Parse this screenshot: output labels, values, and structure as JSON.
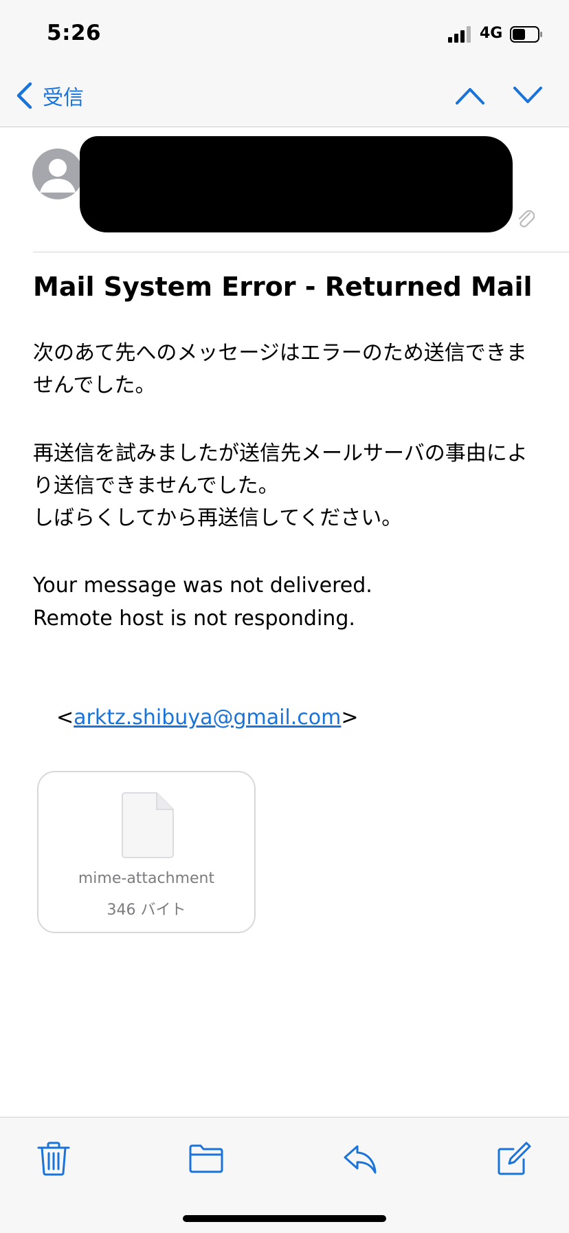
{
  "status_bar": {
    "time": "5:26",
    "network": "4G",
    "icons": [
      "signal-icon",
      "battery-icon"
    ]
  },
  "nav": {
    "back_label": "受信",
    "icons": [
      "chevron-left-icon",
      "chevron-up-icon",
      "chevron-down-icon"
    ]
  },
  "message": {
    "subject": "Mail System Error - Returned Mail",
    "jp_paragraph_1": "次のあて先へのメッセージはエラーのため送信できませんでした。",
    "jp_paragraph_2_line_1": "再送信を試みましたが送信先メールサーバの事由により送信できませんでした。",
    "jp_paragraph_2_line_2": "しばらくしてから再送信してください。",
    "en_line_1": "Your message was not delivered.",
    "en_line_2": "Remote host is not responding.",
    "email_open": "<",
    "email": "arktz.shibuya@gmail.com",
    "email_close": ">"
  },
  "attachment": {
    "name": "mime-attachment",
    "size": "346 バイト"
  },
  "toolbar": {
    "icons": [
      "trash-icon",
      "folder-icon",
      "reply-icon",
      "compose-icon"
    ]
  },
  "colors": {
    "accent": "#1a73d9",
    "bar_background": "#f7f7f7",
    "secondary_text": "#7b7b80"
  }
}
